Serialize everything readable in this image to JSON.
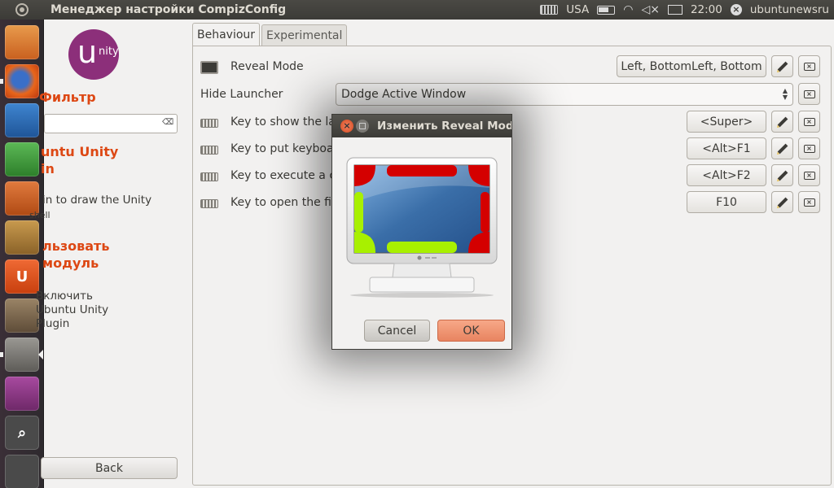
{
  "top_panel": {
    "window_title": "Менеджер настройки CompizConfig",
    "keyboard_layout": "USA",
    "clock": "22:00",
    "username": "ubuntunewsru",
    "icons": [
      "ubuntu-logo-icon",
      "keyboard-icon",
      "battery-icon",
      "wifi-icon",
      "volume-mute-icon",
      "mail-icon",
      "session-icon"
    ]
  },
  "launcher": {
    "items": [
      {
        "name": "home-folder",
        "color": "#d9772e"
      },
      {
        "name": "firefox",
        "color": "#e8661b"
      },
      {
        "name": "libreoffice-writer",
        "color": "#2a6fb0"
      },
      {
        "name": "libreoffice-calc",
        "color": "#3f9f3a"
      },
      {
        "name": "libreoffice-impress",
        "color": "#c8561c"
      },
      {
        "name": "software-center",
        "color": "#a3772d"
      },
      {
        "name": "ubuntu-one",
        "color": "#dd4814"
      },
      {
        "name": "gimp",
        "color": "#7d6a52"
      },
      {
        "name": "compizconfig",
        "color": "#7a7873"
      },
      {
        "name": "workspace-switcher",
        "color": "#8e3a85"
      },
      {
        "name": "lens-search",
        "color": "#4a4a4a"
      },
      {
        "name": "trash",
        "color": "#4a4a4a"
      }
    ]
  },
  "sidebar": {
    "logo_big": "u",
    "logo_small": "nity",
    "filter_heading": "Фильтр",
    "filter_value": "",
    "plugin_heading_line1": "untu Unity",
    "plugin_heading_line2": "in",
    "plugin_desc": "in to draw the Unity",
    "plugin_desc_tail": "shell",
    "use_heading_line1": "льзовать",
    "use_heading_line2": "модуль",
    "enable_line1": "Включить",
    "enable_line2": "Ubuntu Unity",
    "enable_line3": "Plugin",
    "back_label": "Back"
  },
  "tabs": [
    {
      "label": "Behaviour",
      "active": true
    },
    {
      "label": "Experimental",
      "active": false
    }
  ],
  "settings": {
    "reveal_mode": {
      "label": "Reveal Mode",
      "value": "Left, BottomLeft, Bottom"
    },
    "hide_launcher": {
      "label": "Hide Launcher",
      "value": "Dodge Active Window"
    },
    "key_show": {
      "label": "Key to show the lau",
      "value": "<Super>"
    },
    "key_keyboard": {
      "label": "Key to put keyboar",
      "value": "<Alt>F1"
    },
    "key_execute": {
      "label": "Key to execute a co",
      "value": "<Alt>F2"
    },
    "key_open": {
      "label": "Key to open the firs",
      "value": "F10"
    }
  },
  "dialog": {
    "title": "Изменить Reveal Mode",
    "cancel_label": "Cancel",
    "ok_label": "OK",
    "colors": {
      "active_corner": "#d40000",
      "inactive_edge": "#a8f000",
      "screen": "#3a6ea8"
    }
  }
}
